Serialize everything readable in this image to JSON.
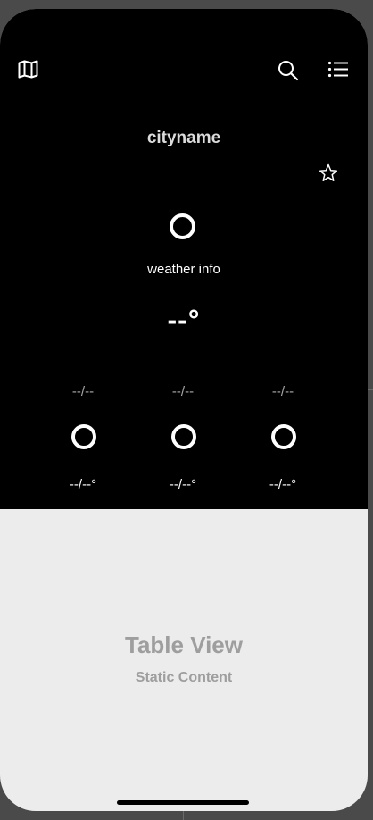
{
  "header": {
    "icons": {
      "map": "map-icon",
      "search": "search-icon",
      "list": "list-icon",
      "favorite": "star-icon"
    }
  },
  "city": {
    "name": "cityname"
  },
  "current": {
    "icon": "weather-ring-icon",
    "info": "weather info",
    "temperature": "--°"
  },
  "forecast": [
    {
      "date": "--/--",
      "icon": "weather-ring-icon",
      "temp": "--/--°"
    },
    {
      "date": "--/--",
      "icon": "weather-ring-icon",
      "temp": "--/--°"
    },
    {
      "date": "--/--",
      "icon": "weather-ring-icon",
      "temp": "--/--°"
    }
  ],
  "table_view": {
    "title": "Table View",
    "subtitle": "Static Content"
  },
  "colors": {
    "top_background": "#000000",
    "bottom_background": "#ececec",
    "text_muted": "#9e9e9e"
  }
}
